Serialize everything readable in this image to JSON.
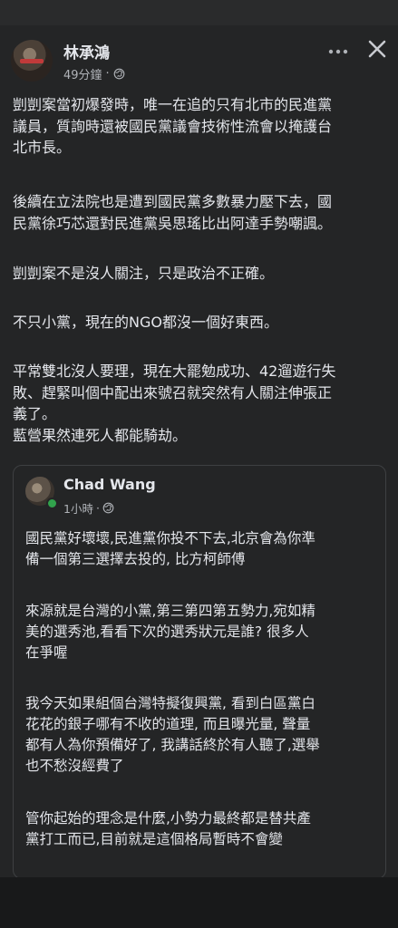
{
  "post": {
    "author": "林承鴻",
    "time": "49分鐘",
    "dot": "·",
    "paragraphs": [
      "剴剴案當初爆發時，唯一在追的只有北市的民進黨\n議員，質詢時還被國民黨議會技術性流會以掩護台\n北市長。",
      "後續在立法院也是遭到國民黨多數暴力壓下去，國\n民黨徐巧芯還對民進黨吳思瑤比出阿達手勢嘲諷。",
      "剴剴案不是沒人關注，只是政治不正確。",
      "不只小黨，現在的NGO都沒一個好東西。",
      "平常雙北沒人要理，現在大罷勉成功、42遛遊行失\n敗、趕緊叫個中配出來號召就突然有人關注伸張正\n義了。\n藍營果然連死人都能騎劫。"
    ]
  },
  "shared": {
    "author": "Chad Wang",
    "time": "1小時",
    "dot": "·",
    "paragraphs": [
      "國民黨好壞壞,民進黨你投不下去,北京會為你準\n備一個第三選擇去投的, 比方柯師傅",
      "來源就是台灣的小黨,第三第四第五勢力,宛如精\n美的選秀池,看看下次的選秀狀元是誰? 很多人\n在爭喔",
      "我今天如果組個台灣特擬復興黨, 看到白區黨白\n花花的銀子哪有不收的道理, 而且曝光量, 聲量\n都有人為你預備好了, 我講話終於有人聽了,選舉\n也不愁沒經費了",
      "管你起始的理念是什麼,小勢力最終都是替共產\n黨打工而已,目前就是這個格局暫時不會變"
    ]
  },
  "icons": {
    "globe": "globe-icon",
    "more": "more-options-icon",
    "close": "close-icon",
    "online": "online-status-icon"
  },
  "colors": {
    "background": "#242526",
    "text": "#e4e6eb",
    "muted": "#b0b3b8",
    "border": "#3e4042",
    "online": "#31a24c"
  }
}
